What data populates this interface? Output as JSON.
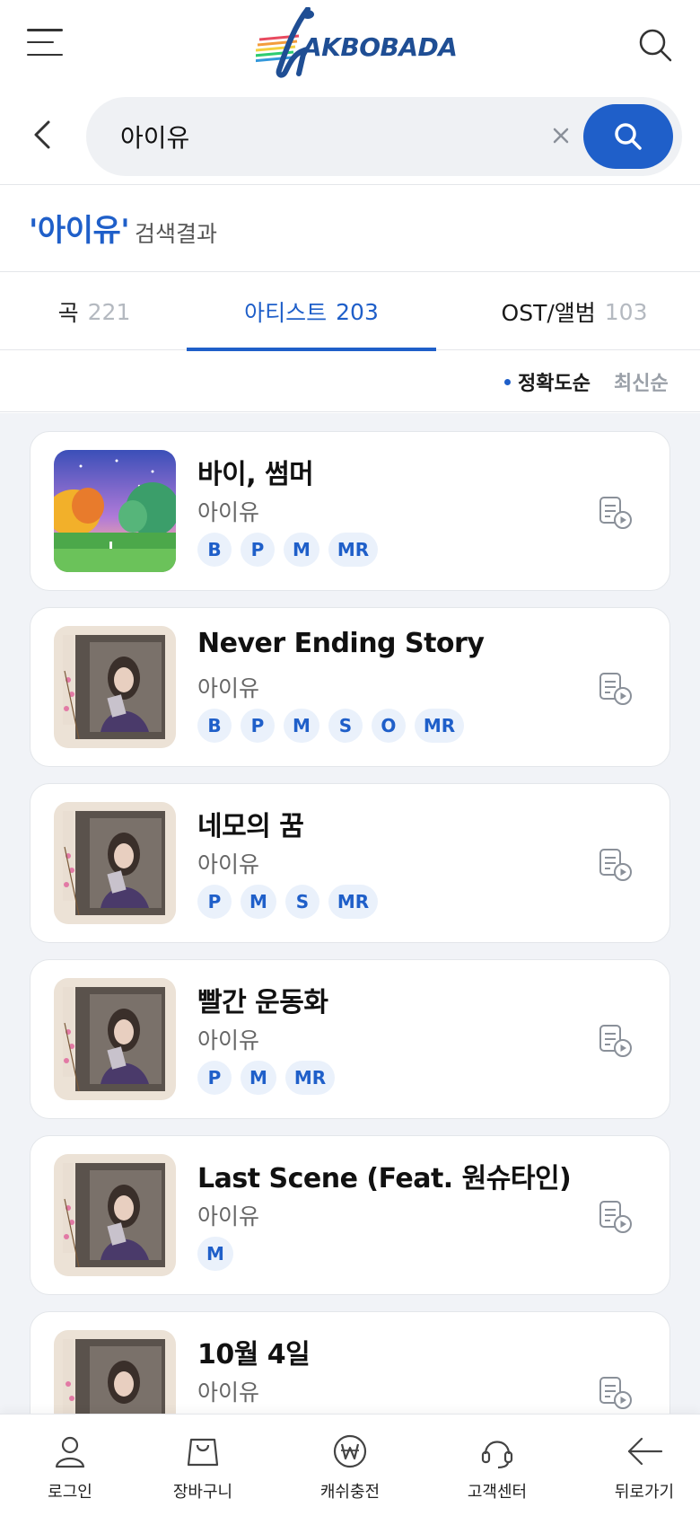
{
  "header": {
    "logo_text": "AKBOBADA",
    "menu_icon": "hamburger-menu-icon",
    "search_icon": "search-icon"
  },
  "search": {
    "value": "아이유",
    "placeholder": ""
  },
  "results": {
    "query": "'아이유'",
    "label": "검색결과"
  },
  "tabs": [
    {
      "name": "곡",
      "count": "221"
    },
    {
      "name": "아티스트",
      "count": "203"
    },
    {
      "name": "OST/앨범",
      "count": "103"
    }
  ],
  "sort": {
    "accuracy": "정확도순",
    "latest": "최신순"
  },
  "songs": [
    {
      "title": "바이, 썸머",
      "artist": "아이유",
      "badges": [
        "B",
        "P",
        "M",
        "MR"
      ]
    },
    {
      "title": "Never Ending Story",
      "artist": "아이유",
      "badges": [
        "B",
        "P",
        "M",
        "S",
        "O",
        "MR"
      ]
    },
    {
      "title": "네모의 꿈",
      "artist": "아이유",
      "badges": [
        "P",
        "M",
        "S",
        "MR"
      ]
    },
    {
      "title": "빨간 운동화",
      "artist": "아이유",
      "badges": [
        "P",
        "M",
        "MR"
      ]
    },
    {
      "title": "Last Scene (Feat. 원슈타인)",
      "artist": "아이유",
      "badges": [
        "M"
      ]
    },
    {
      "title": "10월 4일",
      "artist": "아이유",
      "badges": []
    }
  ],
  "nav": [
    {
      "label": "로그인",
      "icon": "user-icon"
    },
    {
      "label": "장바구니",
      "icon": "shopping-bag-icon"
    },
    {
      "label": "캐쉬충전",
      "icon": "won-coin-icon"
    },
    {
      "label": "고객센터",
      "icon": "headset-icon"
    },
    {
      "label": "뒤로가기",
      "icon": "back-arrow-icon"
    }
  ],
  "colors": {
    "accent": "#1f5fc9",
    "logo": "#1f4e94",
    "badge_bg": "#eaf1fb",
    "list_bg": "#f1f3f7"
  }
}
